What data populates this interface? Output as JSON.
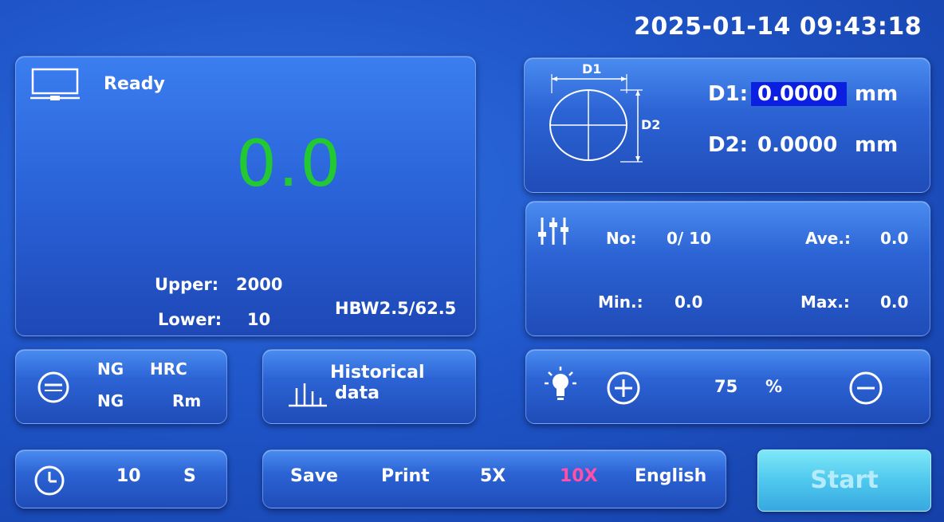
{
  "header": {
    "datetime": "2025-01-14 09:43:18"
  },
  "main": {
    "status": "Ready",
    "reading": "0.0",
    "reading_color": "#22c932",
    "upper_label": "Upper:",
    "upper_value": "2000",
    "lower_label": "Lower:",
    "lower_value": "10",
    "scale": "HBW2.5/62.5",
    "icon": "monitor-icon"
  },
  "diagonals": {
    "diagram_d1": "D1",
    "diagram_d2": "D2",
    "d1_label": "D1:",
    "d1_value": "0.0000",
    "d1_unit": "mm",
    "d2_label": "D2:",
    "d2_value": "0.0000",
    "d2_unit": "mm",
    "d1_highlight": "#0a1fe0"
  },
  "stats": {
    "icon": "sliders-icon",
    "no_label": "No:",
    "no_value": "0/ 10",
    "ave_label": "Ave.:",
    "ave_value": "0.0",
    "min_label": "Min.:",
    "min_value": "0.0",
    "max_label": "Max.:",
    "max_value": "0.0"
  },
  "ng": {
    "icon": "minus-circle-icon",
    "row1_left": "NG",
    "row1_right": "HRC",
    "row2_left": "NG",
    "row2_right": "Rm"
  },
  "historical": {
    "icon": "bar-chart-icon",
    "line1": "Historical",
    "line2": "data"
  },
  "light": {
    "icon": "lightbulb-icon",
    "increase_icon": "plus-circle-icon",
    "decrease_icon": "minus-circle-icon",
    "value": "75",
    "unit": "%"
  },
  "timer": {
    "icon": "clock-icon",
    "value": "10",
    "unit": "S"
  },
  "menu": {
    "save": "Save",
    "print": "Print",
    "zoom5": "5X",
    "zoom10": "10X",
    "language": "English",
    "active_color": "#ff4fa8"
  },
  "start": {
    "label": "Start"
  }
}
